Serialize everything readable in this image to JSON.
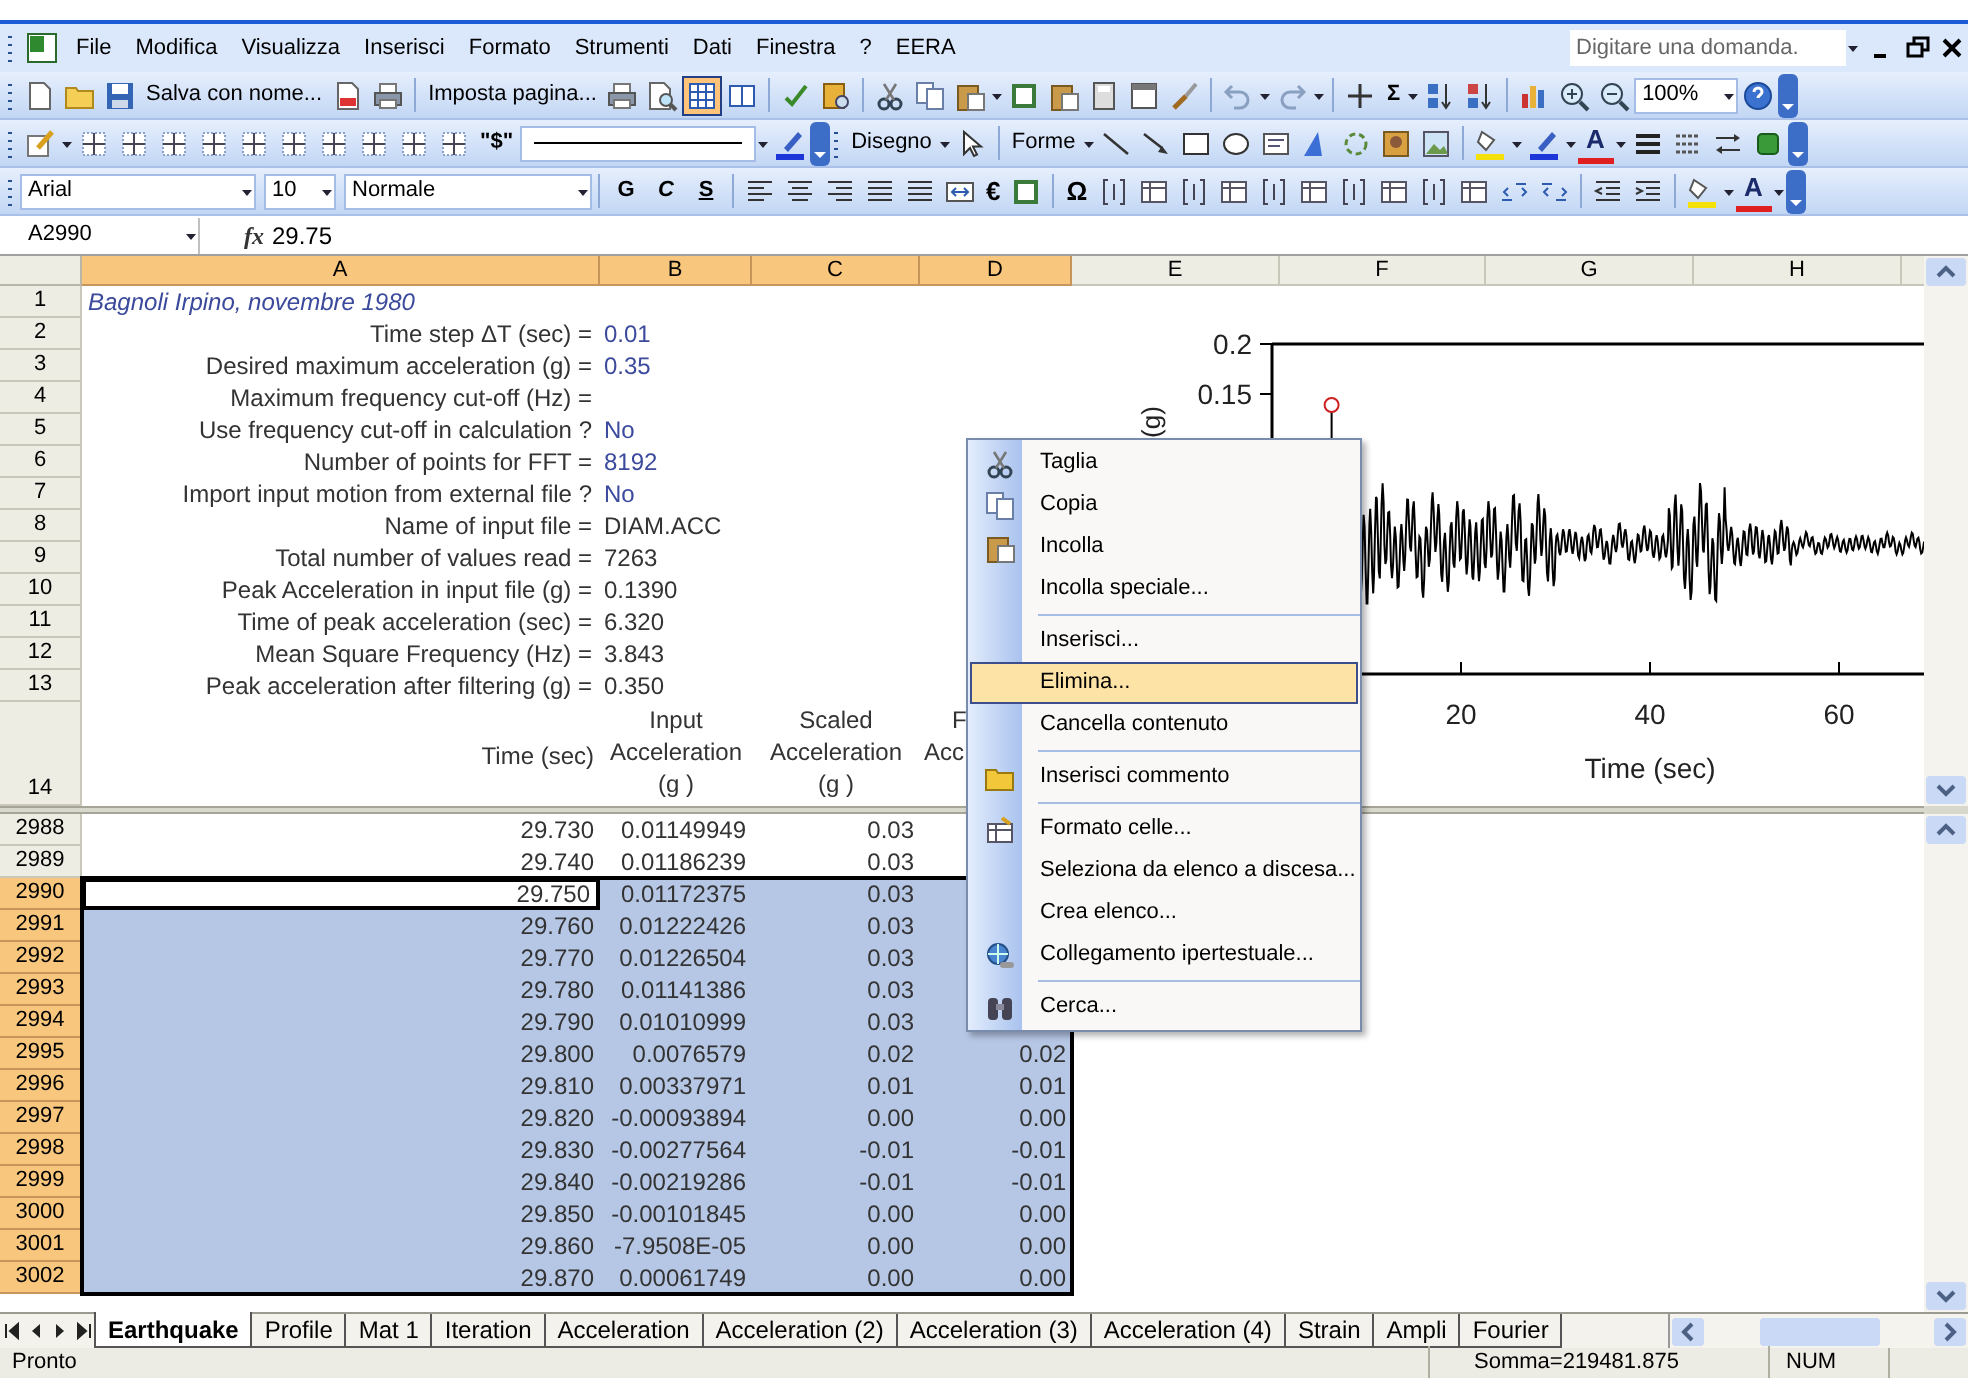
{
  "menu_bar": {
    "items": [
      "File",
      "Modifica",
      "Visualizza",
      "Inserisci",
      "Formato",
      "Strumenti",
      "Dati",
      "Finestra",
      "?",
      "EERA"
    ],
    "question_box": {
      "placeholder": "Digitare una domanda."
    }
  },
  "toolbars": {
    "standard": {
      "save_as": "Salva con nome...",
      "page_setup": "Imposta pagina...",
      "view_toggle": {
        "selected": true
      },
      "sum": "Σ",
      "zoom": "100%"
    },
    "borders": {
      "style_button": "\"$\""
    },
    "drawing": {
      "draw": "Disegno",
      "shapes": "Forme",
      "font_color": "A"
    },
    "formatting": {
      "font": "Arial",
      "size": "10",
      "style": "Normale",
      "bold": "G",
      "italic": "C",
      "underline": "S",
      "euro": "€",
      "symbol": "Ω",
      "font_color": "A"
    }
  },
  "formula_bar": {
    "name_box": "A2990",
    "fx": "fx",
    "formula": "29.75"
  },
  "columns": [
    {
      "label": "A",
      "selected": true
    },
    {
      "label": "B",
      "selected": true
    },
    {
      "label": "C",
      "selected": true
    },
    {
      "label": "D",
      "selected": true
    },
    {
      "label": "E",
      "selected": false
    },
    {
      "label": "F",
      "selected": false
    },
    {
      "label": "G",
      "selected": false
    },
    {
      "label": "H",
      "selected": false
    }
  ],
  "header_rows": [
    {
      "row": "1",
      "kind": "title",
      "label": "Bagnoli Irpino, novembre 1980"
    },
    {
      "row": "2",
      "kind": "param",
      "label": "Time step ΔT (sec) =",
      "value": "0.01",
      "color": "#3b4a9c"
    },
    {
      "row": "3",
      "kind": "param",
      "label": "Desired maximum acceleration (g) =",
      "value": "0.35",
      "color": "#3b4a9c"
    },
    {
      "row": "4",
      "kind": "param",
      "label": "Maximum frequency cut-off (Hz) ="
    },
    {
      "row": "5",
      "kind": "param",
      "label": "Use frequency cut-off in calculation ?",
      "value": "No",
      "color": "#3b4a9c"
    },
    {
      "row": "6",
      "kind": "param",
      "label": "Number of points for FFT =",
      "value": "8192",
      "color": "#3b4a9c"
    },
    {
      "row": "7",
      "kind": "param",
      "label": "Import input motion from external file ?",
      "value": "No",
      "color": "#3b4a9c"
    },
    {
      "row": "8",
      "kind": "param",
      "label": "Name of input file =",
      "value": "DIAM.ACC",
      "color": "#333333"
    },
    {
      "row": "9",
      "kind": "param",
      "label": "Total number of values read =",
      "value": "7263",
      "color": "#333333"
    },
    {
      "row": "10",
      "kind": "param",
      "label": "Peak Acceleration in input file (g) =",
      "value": "0.1390",
      "color": "#333333"
    },
    {
      "row": "11",
      "kind": "param",
      "label": "Time of peak acceleration (sec) =",
      "value": "6.320",
      "color": "#333333"
    },
    {
      "row": "12",
      "kind": "param",
      "label": "Mean Square Frequency (Hz) =",
      "value": "3.843",
      "color": "#333333"
    },
    {
      "row": "13",
      "kind": "param",
      "label": "Peak acceleration after filtering (g) =",
      "value": "0.350",
      "color": "#333333"
    }
  ],
  "heading_row": {
    "row": "14",
    "cells": [
      [
        "Time (sec)"
      ],
      [
        "Input",
        "Acceleration",
        "(g )"
      ],
      [
        "Scaled",
        "Acceleration",
        "(g )"
      ],
      [
        "F",
        "Acc"
      ]
    ]
  },
  "chart": {
    "y_label": "(g)",
    "y_ticks": [
      "0.2",
      "0.15"
    ],
    "x_ticks": [
      "20",
      "40",
      "60"
    ],
    "x_label": "Time (sec)"
  },
  "data_rows": [
    {
      "row": "2988",
      "selected": false,
      "active": false,
      "cells": [
        "29.730",
        "0.01149949",
        "0.03"
      ]
    },
    {
      "row": "2989",
      "selected": false,
      "active": false,
      "cells": [
        "29.740",
        "0.01186239",
        "0.03"
      ]
    },
    {
      "row": "2990",
      "selected": true,
      "active": true,
      "cells": [
        "29.750",
        "0.01172375",
        "0.03"
      ]
    },
    {
      "row": "2991",
      "selected": true,
      "active": false,
      "cells": [
        "29.760",
        "0.01222426",
        "0.03"
      ]
    },
    {
      "row": "2992",
      "selected": true,
      "active": false,
      "cells": [
        "29.770",
        "0.01226504",
        "0.03"
      ]
    },
    {
      "row": "2993",
      "selected": true,
      "active": false,
      "cells": [
        "29.780",
        "0.01141386",
        "0.03"
      ]
    },
    {
      "row": "2994",
      "selected": true,
      "active": false,
      "cells": [
        "29.790",
        "0.01010999",
        "0.03"
      ]
    },
    {
      "row": "2995",
      "selected": true,
      "active": false,
      "cells": [
        "29.800",
        "0.0076579",
        "0.02",
        "0.02"
      ]
    },
    {
      "row": "2996",
      "selected": true,
      "active": false,
      "cells": [
        "29.810",
        "0.00337971",
        "0.01",
        "0.01"
      ]
    },
    {
      "row": "2997",
      "selected": true,
      "active": false,
      "cells": [
        "29.820",
        "-0.00093894",
        "0.00",
        "0.00"
      ]
    },
    {
      "row": "2998",
      "selected": true,
      "active": false,
      "cells": [
        "29.830",
        "-0.00277564",
        "-0.01",
        "-0.01"
      ]
    },
    {
      "row": "2999",
      "selected": true,
      "active": false,
      "cells": [
        "29.840",
        "-0.00219286",
        "-0.01",
        "-0.01"
      ]
    },
    {
      "row": "3000",
      "selected": true,
      "active": false,
      "cells": [
        "29.850",
        "-0.00101845",
        "0.00",
        "0.00"
      ]
    },
    {
      "row": "3001",
      "selected": true,
      "active": false,
      "cells": [
        "29.860",
        "-7.9508E-05",
        "0.00",
        "0.00"
      ]
    },
    {
      "row": "3002",
      "selected": true,
      "active": false,
      "cells": [
        "29.870",
        "0.00061749",
        "0.00",
        "0.00"
      ]
    }
  ],
  "context_menu": [
    {
      "kind": "item",
      "label": "Taglia",
      "selected": false
    },
    {
      "kind": "item",
      "label": "Copia",
      "selected": false
    },
    {
      "kind": "item",
      "label": "Incolla",
      "selected": false
    },
    {
      "kind": "item",
      "label": "Incolla speciale...",
      "selected": false
    },
    {
      "kind": "separator"
    },
    {
      "kind": "item",
      "label": "Inserisci...",
      "selected": false
    },
    {
      "kind": "item",
      "label": "Elimina...",
      "selected": true
    },
    {
      "kind": "item",
      "label": "Cancella contenuto",
      "selected": false
    },
    {
      "kind": "separator"
    },
    {
      "kind": "item",
      "label": "Inserisci commento",
      "selected": false
    },
    {
      "kind": "separator"
    },
    {
      "kind": "item",
      "label": "Formato celle...",
      "selected": false
    },
    {
      "kind": "item",
      "label": "Seleziona da elenco a discesa...",
      "selected": false
    },
    {
      "kind": "item",
      "label": "Crea elenco...",
      "selected": false
    },
    {
      "kind": "item",
      "label": "Collegamento ipertestuale...",
      "selected": false
    },
    {
      "kind": "separator"
    },
    {
      "kind": "item",
      "label": "Cerca...",
      "selected": false
    }
  ],
  "sheet_tabs": [
    {
      "label": "Earthquake",
      "selected": true
    },
    {
      "label": "Profile",
      "selected": false
    },
    {
      "label": "Mat 1",
      "selected": false
    },
    {
      "label": "Iteration",
      "selected": false
    },
    {
      "label": "Acceleration",
      "selected": false
    },
    {
      "label": "Acceleration (2)",
      "selected": false
    },
    {
      "label": "Acceleration (3)",
      "selected": false
    },
    {
      "label": "Acceleration (4)",
      "selected": false
    },
    {
      "label": "Strain",
      "selected": false
    },
    {
      "label": "Ampli",
      "selected": false
    },
    {
      "label": "Fourier",
      "selected": false
    }
  ],
  "status_bar": {
    "mode": "Pronto",
    "sum": "Somma=219481.875",
    "num": "NUM"
  }
}
